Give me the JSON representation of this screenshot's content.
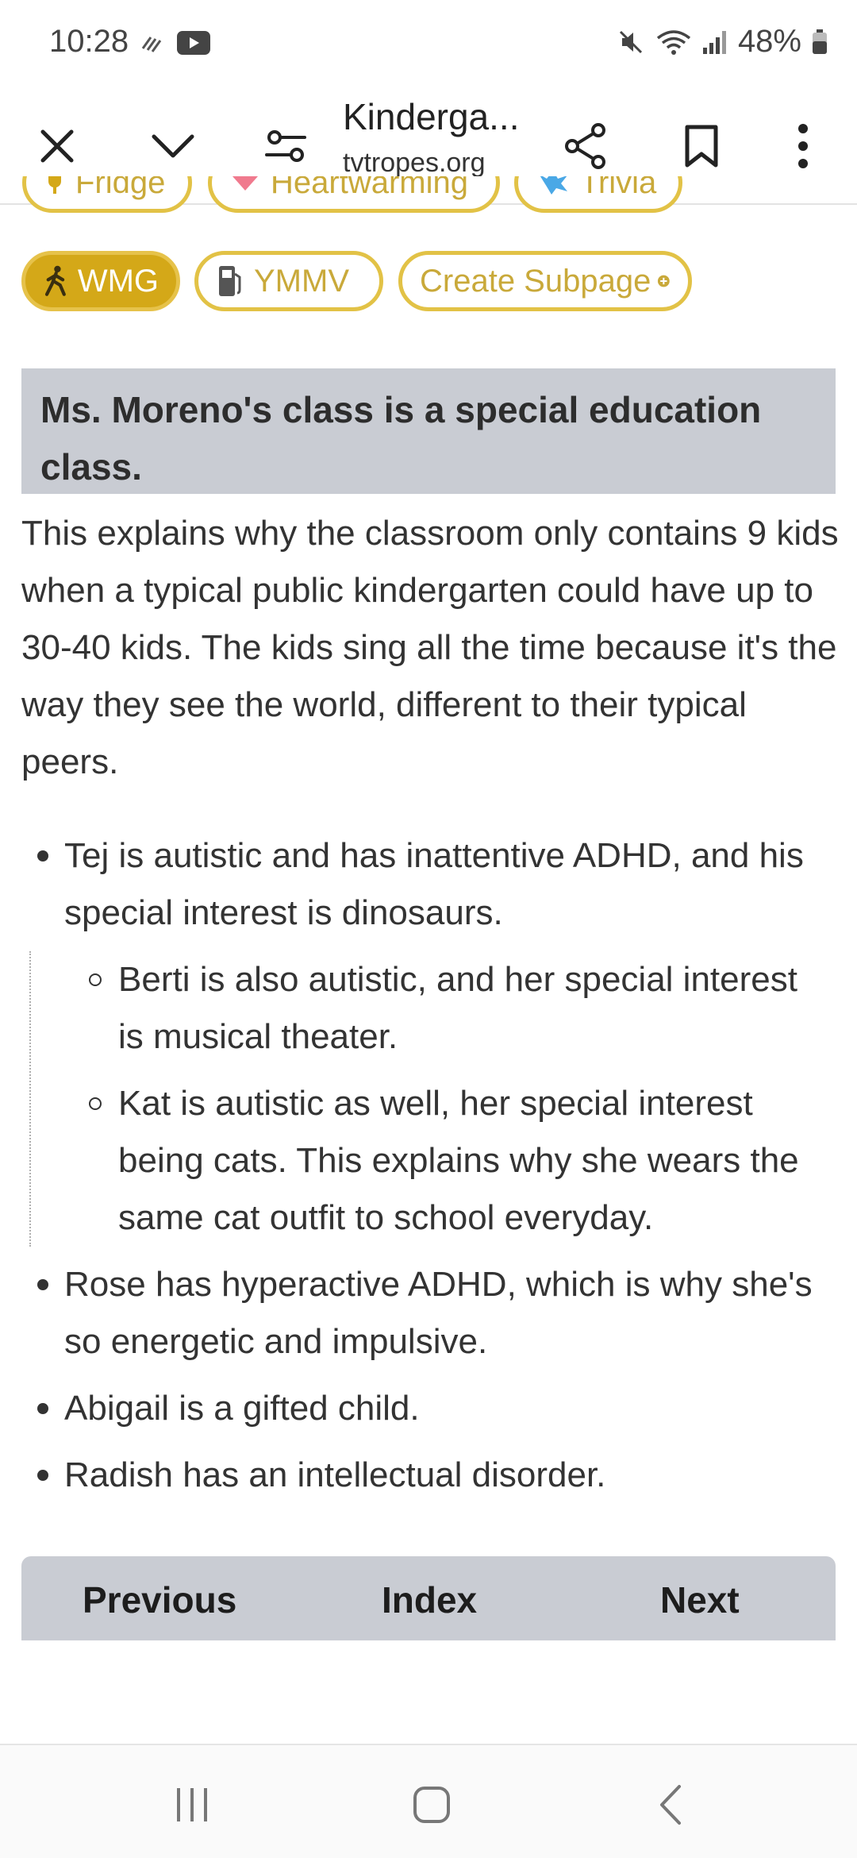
{
  "status_bar": {
    "time": "10:28",
    "battery": "48%"
  },
  "toolbar": {
    "title": "Kinderga...",
    "domain": "tvtropes.org"
  },
  "pills_partial": [
    {
      "label": "Fridge"
    },
    {
      "label": "Heartwarming"
    },
    {
      "label": "Trivia"
    }
  ],
  "pills": [
    {
      "label": "WMG",
      "active": true
    },
    {
      "label": "YMMV",
      "active": false
    },
    {
      "label": "Create Subpage",
      "active": false
    }
  ],
  "article": {
    "heading": "Ms. Moreno's class is a special education class.",
    "paragraph": "This explains why the classroom only contains 9 kids when a typical public kindergarten could have up to 30-40 kids. The kids sing all the time because it's the way they see the world, different to their typical peers.",
    "bullets": [
      {
        "text": "Tej is autistic and has inattentive ADHD, and his special interest is dinosaurs."
      },
      {
        "text": "Berti is also autistic, and her special interest is musical theater."
      },
      {
        "text": "Kat is autistic as well, her special interest being cats. This explains why she wears the same cat outfit to school everyday."
      },
      {
        "text": "Rose has hyperactive ADHD, which is why she's so energetic and impulsive."
      },
      {
        "text": "Abigail is a gifted child."
      },
      {
        "text": "Radish has an intellectual disorder."
      }
    ]
  },
  "page_nav": {
    "previous": "Previous",
    "index": "Index",
    "next": "Next"
  },
  "colors": {
    "pill_border": "#e2c246",
    "pill_active_bg": "#d4a818",
    "heading_bg": "#c9ccd3"
  }
}
